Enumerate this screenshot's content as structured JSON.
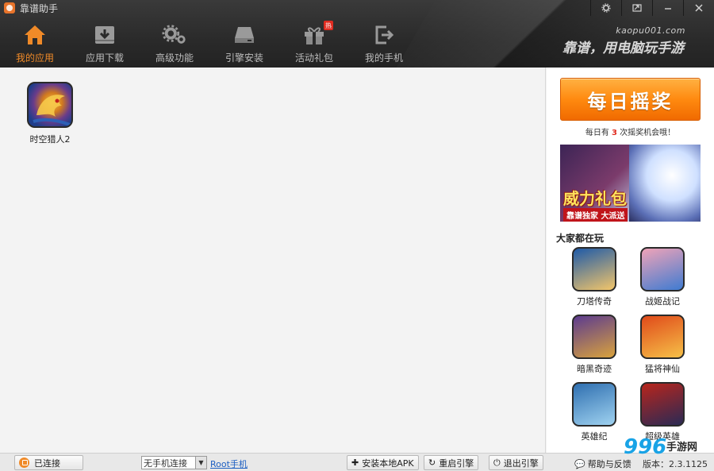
{
  "app": {
    "title": "靠谱助手"
  },
  "window_controls": [
    "settings-icon",
    "minimize-to-tray-icon",
    "minimize-icon",
    "close-icon"
  ],
  "nav": [
    {
      "label": "我的应用",
      "icon": "home-icon",
      "active": true
    },
    {
      "label": "应用下载",
      "icon": "download-icon",
      "active": false
    },
    {
      "label": "高级功能",
      "icon": "gears-icon",
      "active": false
    },
    {
      "label": "引擎安装",
      "icon": "drive-icon",
      "active": false
    },
    {
      "label": "活动礼包",
      "icon": "gift-icon",
      "active": false,
      "badge": "热"
    },
    {
      "label": "我的手机",
      "icon": "exit-icon",
      "active": false
    }
  ],
  "brand": {
    "url": "kaopu001.com",
    "slogan": "靠谱，用电脑玩手游"
  },
  "my_apps": [
    {
      "name": "时空猎人2",
      "icon": "dragon-game-icon"
    }
  ],
  "sidebar": {
    "lottery_button": "每日摇奖",
    "lottery_note": {
      "prefix": "每日有",
      "count": "3",
      "suffix": "次摇奖机会哦！"
    },
    "banner": {
      "title": "威力礼包",
      "subtitle": "靠谱独家 大派送"
    },
    "popular_title": "大家都在玩",
    "popular": [
      {
        "name": "刀塔传奇",
        "colors": [
          "#1e5aa8",
          "#f3c66a"
        ]
      },
      {
        "name": "战姬战记",
        "colors": [
          "#f0a3b8",
          "#3f7bd1"
        ]
      },
      {
        "name": "暗黑奇迹",
        "colors": [
          "#5c3b8f",
          "#d9a23d"
        ]
      },
      {
        "name": "猛将神仙",
        "colors": [
          "#e04a1a",
          "#f6c048"
        ]
      },
      {
        "name": "英雄纪",
        "colors": [
          "#2f6fb0",
          "#9fd2f0"
        ]
      },
      {
        "name": "超级英雄",
        "colors": [
          "#b8251c",
          "#2a2a55"
        ]
      }
    ]
  },
  "statusbar": {
    "connection": "已连接",
    "device_select": "无手机连接",
    "root_link": "Root手机",
    "install_apk": "安装本地APK",
    "restart_engine": "重启引擎",
    "exit_engine": "退出引擎",
    "feedback": "帮助与反馈",
    "version": "版本：2.3.1125"
  },
  "watermark": {
    "number": "996",
    "text": "手游网"
  },
  "colors": {
    "accent": "#f08a28",
    "header": "#2a2a2a",
    "link": "#1d5fc2"
  }
}
